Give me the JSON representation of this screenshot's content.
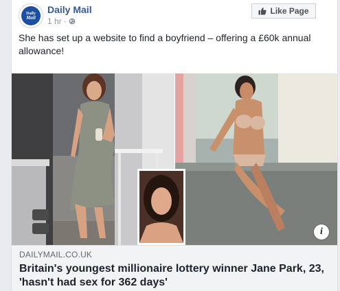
{
  "post": {
    "page_name": "Daily Mail",
    "time": "1 hr",
    "like_button": "Like Page",
    "text": "She has set up a website to find a boyfriend – offering a £60k annual allowance!",
    "avatar_text_top": "Daily",
    "avatar_text_bottom": "Mail"
  },
  "link": {
    "domain": "DAILYMAIL.CO.UK",
    "headline": "Britain's youngest millionaire lottery winner Jane Park, 23, 'hasn't had sex for 362 days'",
    "info_icon": "i"
  },
  "icons": {
    "globe": "globe-icon",
    "like": "thumbs-up-icon",
    "info": "info-icon"
  },
  "colors": {
    "link_blue": "#365899",
    "brand_blue": "#1c4fa0",
    "meta_gray": "#90949c",
    "footer_bg": "#f2f3f5"
  }
}
